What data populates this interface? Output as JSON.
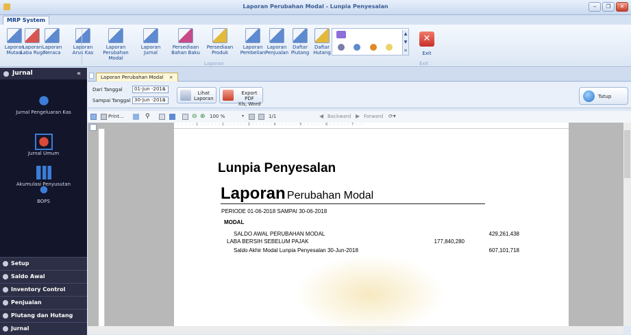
{
  "window": {
    "title": "Laporan Perubahan Modal - Lunpia Penyesalan"
  },
  "app": {
    "tab": "MRP System"
  },
  "ribbon": {
    "buttons": [
      {
        "line1": "Laporan",
        "line2": "Mutasi",
        "icon": "ledger-x-icon"
      },
      {
        "line1": "Laporan",
        "line2": "Laba Rugi",
        "icon": "ledger-plus-icon"
      },
      {
        "line1": "Laporan",
        "line2": "Neraca",
        "icon": "ledger-x-icon"
      },
      {
        "line1": "Laporan",
        "line2": "Arus Kas",
        "icon": "ledger-bracket-icon"
      },
      {
        "line1": "Laporan",
        "line2": "Perubahan Modal",
        "icon": "ledger-percent-icon"
      },
      {
        "line1": "Laporan",
        "line2": "Jurnal",
        "icon": "ledger-10-icon"
      },
      {
        "line1": "Persediaan",
        "line2": "Bahan Baku",
        "icon": "stock-icon"
      },
      {
        "line1": "Persediaan",
        "line2": "Produk",
        "icon": "grid-icon"
      },
      {
        "line1": "Laporan",
        "line2": "Pembelian",
        "icon": "ledger-doc-icon"
      },
      {
        "line1": "Laporan",
        "line2": "Penjualan",
        "icon": "ledger-doc-icon"
      },
      {
        "line1": "Daftar",
        "line2": "Piutang",
        "icon": "ledger-arrow-icon"
      },
      {
        "line1": "Daftar",
        "line2": "Hutang",
        "icon": "grid-icon"
      }
    ],
    "group_label": "Laporan",
    "exit_label": "Exit",
    "exit_group": "Exit"
  },
  "nav": {
    "header": "Jurnal",
    "items": [
      "Jurnal Pengeluaran Kas",
      "Jurnal Umum",
      "Akumulasi Penyusutan",
      "BOPS"
    ],
    "sections": [
      "Setup",
      "Saldo Awal",
      "Inventory Control",
      "Penjualan",
      "Piutang dan Hutang",
      "Jurnal"
    ]
  },
  "doc_tab": {
    "label": "Laporan Perubahan Modal",
    "close": "×"
  },
  "filter": {
    "from_label": "Dari Tanggal",
    "from_value": "01-Jun -2018",
    "to_label": "Sampai Tanggal",
    "to_value": "30-Jun -2018",
    "view_line1": "Lihat",
    "view_line2": "Laporan",
    "export_line1": "Export PDF",
    "export_line2": "Xls, Word",
    "close_label": "Tutup"
  },
  "toolbar": {
    "print": "Print...",
    "zoom": "100 %",
    "page": "1/1",
    "backward": "Backward",
    "forward": "Forward"
  },
  "ruler": "· · · · · 1 · · · · · · 2 · · · · · · 3 · · · · · · 4 · · · · · · 5 · · · · · · 6 · · · · · · 7 · · ·",
  "report": {
    "company": "Lunpia Penyesalan",
    "title_big": "Laporan",
    "title_small": "Perubahan Modal",
    "period": "PERIODE 01-06-2018 SAMPAI 30-06-2018",
    "section": "MODAL",
    "rows": [
      {
        "label": "SALDO AWAL PERUBAHAN MODAL",
        "mid": "",
        "right": "429,261,438"
      },
      {
        "label": "LABA BERSIH SEBELUM PAJAK",
        "mid": "177,840,280",
        "right": ""
      },
      {
        "label": "Saldo Akhir Modal Lunpia Penyesalan 30-Jun-2018",
        "mid": "",
        "right": "607,101,718"
      }
    ]
  }
}
